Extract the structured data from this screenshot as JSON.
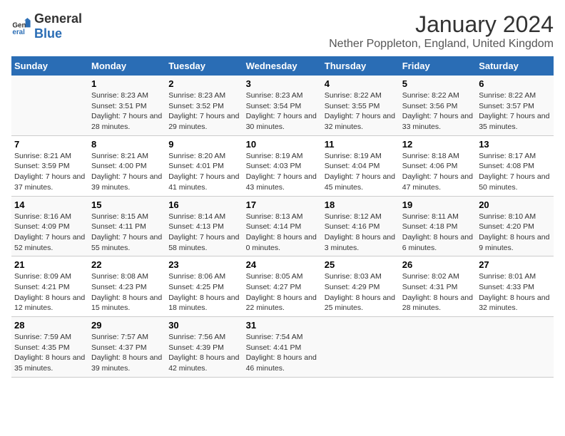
{
  "header": {
    "logo_general": "General",
    "logo_blue": "Blue",
    "main_title": "January 2024",
    "subtitle": "Nether Poppleton, England, United Kingdom"
  },
  "columns": [
    "Sunday",
    "Monday",
    "Tuesday",
    "Wednesday",
    "Thursday",
    "Friday",
    "Saturday"
  ],
  "weeks": [
    [
      {
        "day": "",
        "sunrise": "",
        "sunset": "",
        "daylight": ""
      },
      {
        "day": "1",
        "sunrise": "Sunrise: 8:23 AM",
        "sunset": "Sunset: 3:51 PM",
        "daylight": "Daylight: 7 hours and 28 minutes."
      },
      {
        "day": "2",
        "sunrise": "Sunrise: 8:23 AM",
        "sunset": "Sunset: 3:52 PM",
        "daylight": "Daylight: 7 hours and 29 minutes."
      },
      {
        "day": "3",
        "sunrise": "Sunrise: 8:23 AM",
        "sunset": "Sunset: 3:54 PM",
        "daylight": "Daylight: 7 hours and 30 minutes."
      },
      {
        "day": "4",
        "sunrise": "Sunrise: 8:22 AM",
        "sunset": "Sunset: 3:55 PM",
        "daylight": "Daylight: 7 hours and 32 minutes."
      },
      {
        "day": "5",
        "sunrise": "Sunrise: 8:22 AM",
        "sunset": "Sunset: 3:56 PM",
        "daylight": "Daylight: 7 hours and 33 minutes."
      },
      {
        "day": "6",
        "sunrise": "Sunrise: 8:22 AM",
        "sunset": "Sunset: 3:57 PM",
        "daylight": "Daylight: 7 hours and 35 minutes."
      }
    ],
    [
      {
        "day": "7",
        "sunrise": "Sunrise: 8:21 AM",
        "sunset": "Sunset: 3:59 PM",
        "daylight": "Daylight: 7 hours and 37 minutes."
      },
      {
        "day": "8",
        "sunrise": "Sunrise: 8:21 AM",
        "sunset": "Sunset: 4:00 PM",
        "daylight": "Daylight: 7 hours and 39 minutes."
      },
      {
        "day": "9",
        "sunrise": "Sunrise: 8:20 AM",
        "sunset": "Sunset: 4:01 PM",
        "daylight": "Daylight: 7 hours and 41 minutes."
      },
      {
        "day": "10",
        "sunrise": "Sunrise: 8:19 AM",
        "sunset": "Sunset: 4:03 PM",
        "daylight": "Daylight: 7 hours and 43 minutes."
      },
      {
        "day": "11",
        "sunrise": "Sunrise: 8:19 AM",
        "sunset": "Sunset: 4:04 PM",
        "daylight": "Daylight: 7 hours and 45 minutes."
      },
      {
        "day": "12",
        "sunrise": "Sunrise: 8:18 AM",
        "sunset": "Sunset: 4:06 PM",
        "daylight": "Daylight: 7 hours and 47 minutes."
      },
      {
        "day": "13",
        "sunrise": "Sunrise: 8:17 AM",
        "sunset": "Sunset: 4:08 PM",
        "daylight": "Daylight: 7 hours and 50 minutes."
      }
    ],
    [
      {
        "day": "14",
        "sunrise": "Sunrise: 8:16 AM",
        "sunset": "Sunset: 4:09 PM",
        "daylight": "Daylight: 7 hours and 52 minutes."
      },
      {
        "day": "15",
        "sunrise": "Sunrise: 8:15 AM",
        "sunset": "Sunset: 4:11 PM",
        "daylight": "Daylight: 7 hours and 55 minutes."
      },
      {
        "day": "16",
        "sunrise": "Sunrise: 8:14 AM",
        "sunset": "Sunset: 4:13 PM",
        "daylight": "Daylight: 7 hours and 58 minutes."
      },
      {
        "day": "17",
        "sunrise": "Sunrise: 8:13 AM",
        "sunset": "Sunset: 4:14 PM",
        "daylight": "Daylight: 8 hours and 0 minutes."
      },
      {
        "day": "18",
        "sunrise": "Sunrise: 8:12 AM",
        "sunset": "Sunset: 4:16 PM",
        "daylight": "Daylight: 8 hours and 3 minutes."
      },
      {
        "day": "19",
        "sunrise": "Sunrise: 8:11 AM",
        "sunset": "Sunset: 4:18 PM",
        "daylight": "Daylight: 8 hours and 6 minutes."
      },
      {
        "day": "20",
        "sunrise": "Sunrise: 8:10 AM",
        "sunset": "Sunset: 4:20 PM",
        "daylight": "Daylight: 8 hours and 9 minutes."
      }
    ],
    [
      {
        "day": "21",
        "sunrise": "Sunrise: 8:09 AM",
        "sunset": "Sunset: 4:21 PM",
        "daylight": "Daylight: 8 hours and 12 minutes."
      },
      {
        "day": "22",
        "sunrise": "Sunrise: 8:08 AM",
        "sunset": "Sunset: 4:23 PM",
        "daylight": "Daylight: 8 hours and 15 minutes."
      },
      {
        "day": "23",
        "sunrise": "Sunrise: 8:06 AM",
        "sunset": "Sunset: 4:25 PM",
        "daylight": "Daylight: 8 hours and 18 minutes."
      },
      {
        "day": "24",
        "sunrise": "Sunrise: 8:05 AM",
        "sunset": "Sunset: 4:27 PM",
        "daylight": "Daylight: 8 hours and 22 minutes."
      },
      {
        "day": "25",
        "sunrise": "Sunrise: 8:03 AM",
        "sunset": "Sunset: 4:29 PM",
        "daylight": "Daylight: 8 hours and 25 minutes."
      },
      {
        "day": "26",
        "sunrise": "Sunrise: 8:02 AM",
        "sunset": "Sunset: 4:31 PM",
        "daylight": "Daylight: 8 hours and 28 minutes."
      },
      {
        "day": "27",
        "sunrise": "Sunrise: 8:01 AM",
        "sunset": "Sunset: 4:33 PM",
        "daylight": "Daylight: 8 hours and 32 minutes."
      }
    ],
    [
      {
        "day": "28",
        "sunrise": "Sunrise: 7:59 AM",
        "sunset": "Sunset: 4:35 PM",
        "daylight": "Daylight: 8 hours and 35 minutes."
      },
      {
        "day": "29",
        "sunrise": "Sunrise: 7:57 AM",
        "sunset": "Sunset: 4:37 PM",
        "daylight": "Daylight: 8 hours and 39 minutes."
      },
      {
        "day": "30",
        "sunrise": "Sunrise: 7:56 AM",
        "sunset": "Sunset: 4:39 PM",
        "daylight": "Daylight: 8 hours and 42 minutes."
      },
      {
        "day": "31",
        "sunrise": "Sunrise: 7:54 AM",
        "sunset": "Sunset: 4:41 PM",
        "daylight": "Daylight: 8 hours and 46 minutes."
      },
      {
        "day": "",
        "sunrise": "",
        "sunset": "",
        "daylight": ""
      },
      {
        "day": "",
        "sunrise": "",
        "sunset": "",
        "daylight": ""
      },
      {
        "day": "",
        "sunrise": "",
        "sunset": "",
        "daylight": ""
      }
    ]
  ]
}
